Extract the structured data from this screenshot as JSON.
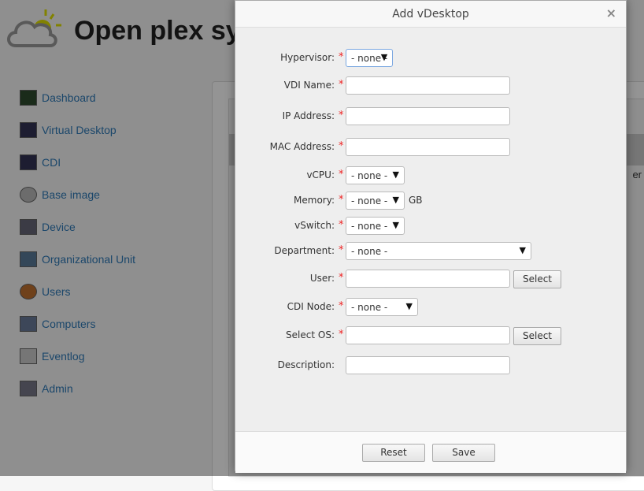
{
  "app": {
    "title": "Open plex sy"
  },
  "sidebar": {
    "items": [
      {
        "label": "Dashboard",
        "icon": "dashboard-icon"
      },
      {
        "label": "Virtual Desktop",
        "icon": "monitor-icon"
      },
      {
        "label": "CDI",
        "icon": "monitor-icon"
      },
      {
        "label": "Base image",
        "icon": "disc-icon"
      },
      {
        "label": "Device",
        "icon": "computer-icon"
      },
      {
        "label": "Organizational Unit",
        "icon": "folder-icon"
      },
      {
        "label": "Users",
        "icon": "user-icon"
      },
      {
        "label": "Computers",
        "icon": "computers-icon"
      },
      {
        "label": "Eventlog",
        "icon": "log-icon"
      },
      {
        "label": "Admin",
        "icon": "tools-icon"
      }
    ]
  },
  "background": {
    "column_fragment": "er"
  },
  "dialog": {
    "title": "Add vDesktop",
    "close": "×",
    "fields": {
      "hypervisor": {
        "label": "Hypervisor:",
        "value": "- none -"
      },
      "vdi_name": {
        "label": "VDI Name:",
        "value": ""
      },
      "ip": {
        "label": "IP Address:",
        "value": ""
      },
      "mac": {
        "label": "MAC Address:",
        "value": ""
      },
      "vcpu": {
        "label": "vCPU:",
        "value": "- none -"
      },
      "memory": {
        "label": "Memory:",
        "value": "- none -",
        "unit": "GB"
      },
      "vswitch": {
        "label": "vSwitch:",
        "value": "- none -"
      },
      "department": {
        "label": "Department:",
        "value": "- none -"
      },
      "user": {
        "label": "User:",
        "value": "",
        "button": "Select"
      },
      "cdi_node": {
        "label": "CDI Node:",
        "value": "- none -"
      },
      "os": {
        "label": "Select OS:",
        "value": "",
        "button": "Select"
      },
      "description": {
        "label": "Description:",
        "value": ""
      }
    },
    "required_mark": "*",
    "reset": "Reset",
    "save": "Save"
  }
}
